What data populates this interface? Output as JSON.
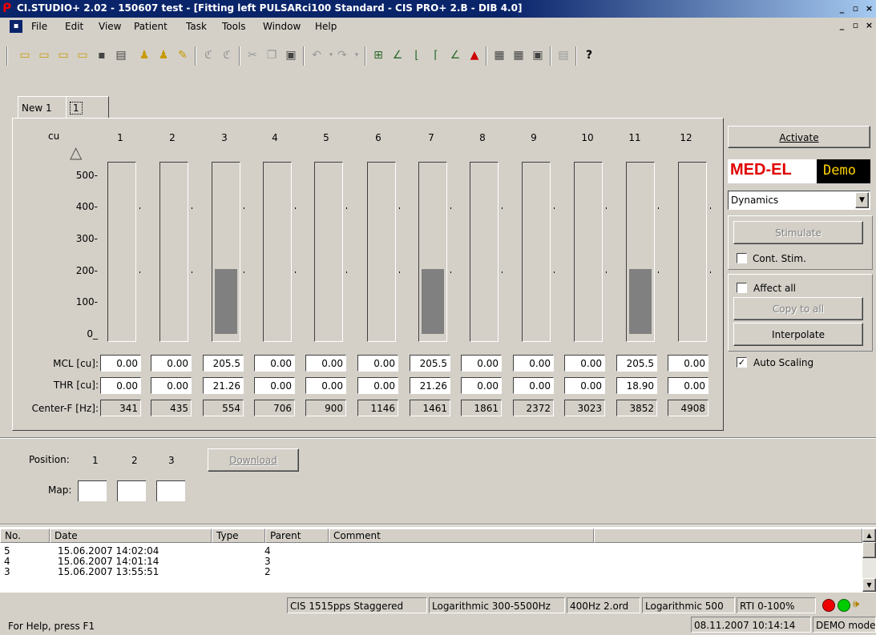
{
  "window": {
    "title": "CI.STUDIO+ 2.02 - 150607 test - [Fitting left  PULSARci100 Standard - CIS PRO+ 2.B - DIB 4.0]"
  },
  "menu": [
    "File",
    "Edit",
    "View",
    "Patient",
    "Task",
    "Tools",
    "Window",
    "Help"
  ],
  "tabs": [
    "New 1",
    "1"
  ],
  "chart_data": {
    "type": "bar",
    "ylabel": "cu",
    "y_ticks": [
      "500-",
      "400-",
      "300-",
      "200-",
      "100-",
      "0_"
    ],
    "categories": [
      "1",
      "2",
      "3",
      "4",
      "5",
      "6",
      "7",
      "8",
      "9",
      "10",
      "11",
      "12"
    ],
    "series": [
      {
        "name": "MCL [cu]:",
        "values": [
          0.0,
          0.0,
          205.5,
          0.0,
          0.0,
          0.0,
          205.5,
          0.0,
          0.0,
          0.0,
          205.5,
          0.0
        ]
      }
    ],
    "ylim": [
      0,
      540
    ]
  },
  "rows": {
    "mcl_label": "MCL [cu]:",
    "thr_label": "THR [cu]:",
    "cf_label": "Center-F [Hz]:",
    "mcl": [
      "0.00",
      "0.00",
      "205.5",
      "0.00",
      "0.00",
      "0.00",
      "205.5",
      "0.00",
      "0.00",
      "0.00",
      "205.5",
      "0.00"
    ],
    "thr": [
      "0.00",
      "0.00",
      "21.26",
      "0.00",
      "0.00",
      "0.00",
      "21.26",
      "0.00",
      "0.00",
      "0.00",
      "18.90",
      "0.00"
    ],
    "cf": [
      "341",
      "435",
      "554",
      "706",
      "900",
      "1146",
      "1461",
      "1861",
      "2372",
      "3023",
      "3852",
      "4908"
    ]
  },
  "right_panel": {
    "activate": "Activate",
    "logo_brand": "MED-EL",
    "logo_demo": "Demo",
    "dropdown": "Dynamics",
    "stimulate": "Stimulate",
    "cont_stim": "Cont. Stim.",
    "affect_all": "Affect all",
    "copy_to_all": "Copy to all",
    "interpolate": "Interpolate",
    "auto_scaling": "Auto Scaling",
    "auto_scaling_checked": true
  },
  "position": {
    "label": "Position:",
    "nums": [
      "1",
      "2",
      "3"
    ],
    "download": "Download",
    "map_label": "Map:"
  },
  "list": {
    "headers": [
      "No.",
      "Date",
      "Type",
      "Parent",
      "Comment"
    ],
    "rows": [
      {
        "no": "5",
        "date": "15.06.2007 14:02:04",
        "type": "",
        "parent": "4"
      },
      {
        "no": "4",
        "date": "15.06.2007 14:01:14",
        "type": "",
        "parent": "3"
      },
      {
        "no": "3",
        "date": "15.06.2007 13:55:51",
        "type": "",
        "parent": "2"
      }
    ]
  },
  "statusbar": {
    "s1": "CIS 1515pps Staggered",
    "s2": "Logarithmic 300-5500Hz",
    "s3": "400Hz 2.ord",
    "s4": "Logarithmic 500",
    "s5": "RTI 0-100%",
    "help": "For Help, press F1",
    "datetime": "08.11.2007 10:14:14",
    "mode": "DEMO mode"
  }
}
